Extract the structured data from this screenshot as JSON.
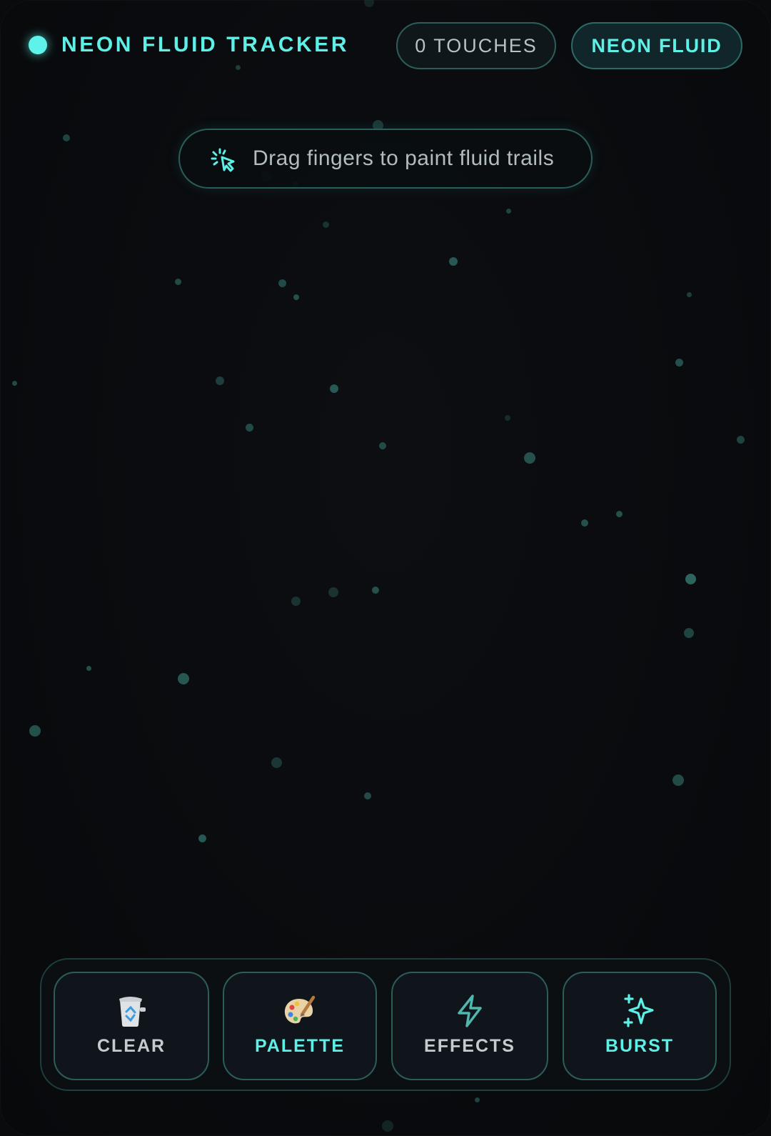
{
  "header": {
    "app_title": "NEON FLUID TRACKER",
    "touches_label": "0 TOUCHES",
    "mode_label": "NEON FLUID"
  },
  "hint": {
    "icon": "pointer-click-icon",
    "text": "Drag fingers to paint fluid trails"
  },
  "toolbar": {
    "buttons": [
      {
        "label": "CLEAR",
        "icon": "recycle-bin-icon"
      },
      {
        "label": "PALETTE",
        "icon": "palette-icon"
      },
      {
        "label": "EFFECTS",
        "icon": "lightning-icon"
      },
      {
        "label": "BURST",
        "icon": "sparkles-icon"
      }
    ]
  },
  "colors": {
    "accent": "#5ef0e6",
    "background": "#0a0b0d",
    "border": "#2b5e5a",
    "muted_text": "#b2bcbe"
  }
}
